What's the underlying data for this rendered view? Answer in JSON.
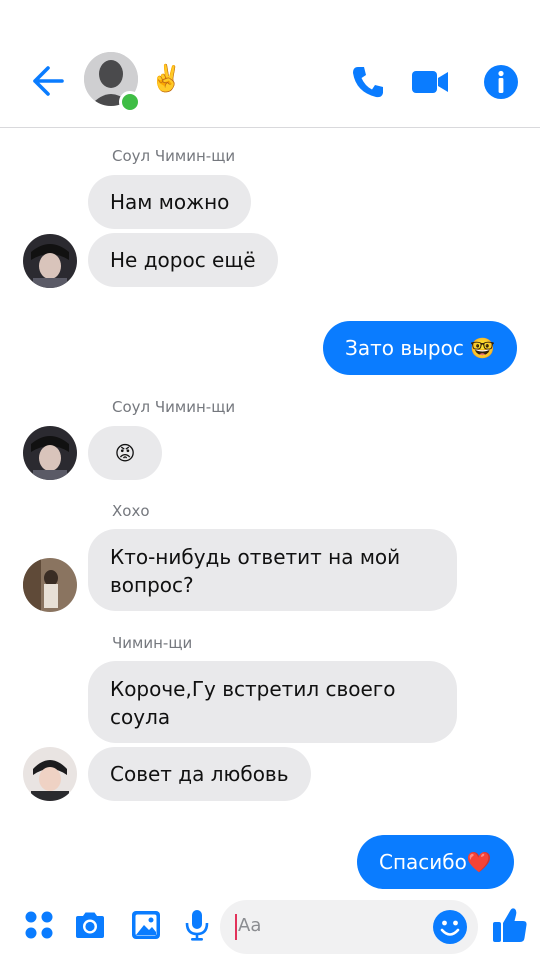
{
  "header": {
    "contact_emoji": "✌️",
    "colors": {
      "accent": "#0a7cff",
      "online": "#3fbd45"
    }
  },
  "messages": [
    {
      "sender": "Соул Чимин-щи",
      "texts": [
        "Нам можно",
        "Не дорос ещё"
      ]
    },
    {
      "me": true,
      "text": "Зато вырос 🤓"
    },
    {
      "sender": "Соул Чимин-щи",
      "texts": [
        "😡"
      ]
    },
    {
      "sender": "Хохо",
      "texts": [
        "Кто-нибудь ответит на мой\nвопрос?"
      ]
    },
    {
      "sender": "Чимин-щи",
      "texts": [
        "Короче,Гу встретил своего\nсоула",
        "Совет да любовь"
      ]
    },
    {
      "me": true,
      "text": "Спасибо❤️"
    }
  ],
  "composer": {
    "placeholder": "Aa",
    "icons": [
      "apps-icon",
      "camera-icon",
      "gallery-icon",
      "microphone-icon",
      "emoji-icon",
      "thumbs-up-icon"
    ]
  }
}
